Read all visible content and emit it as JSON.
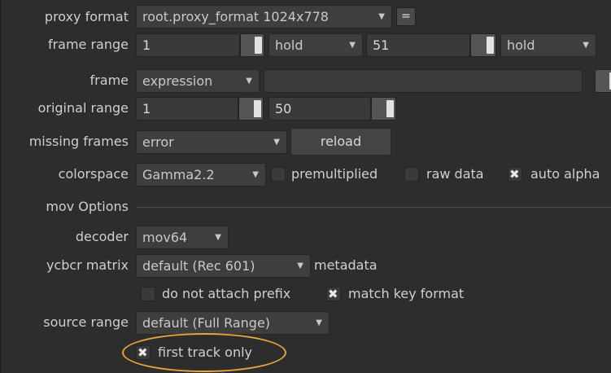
{
  "labels": {
    "proxy_format": "proxy format",
    "frame_range": "frame range",
    "frame": "frame",
    "original_range": "original range",
    "missing_frames": "missing frames",
    "colorspace": "colorspace",
    "mov_options": "mov Options",
    "decoder": "decoder",
    "ycbcr_matrix": "ycbcr matrix",
    "source_range": "source range"
  },
  "proxy_format": {
    "value": "root.proxy_format 1024x778",
    "eq": "="
  },
  "frame_range": {
    "start": "1",
    "start_mode": "hold",
    "end": "51",
    "end_mode": "hold"
  },
  "frame": {
    "mode": "expression",
    "expression": ""
  },
  "original_range": {
    "start": "1",
    "end": "50"
  },
  "missing_frames": {
    "value": "error",
    "reload": "reload"
  },
  "colorspace": {
    "value": "Gamma2.2",
    "premultiplied": {
      "label": "premultiplied",
      "checked": false
    },
    "raw_data": {
      "label": "raw data",
      "checked": false
    },
    "auto_alpha": {
      "label": "auto alpha",
      "checked": true
    }
  },
  "decoder": {
    "value": "mov64"
  },
  "ycbcr_matrix": {
    "value": "default (Rec 601)",
    "metadata": "metadata"
  },
  "do_not_attach_prefix": {
    "label": "do not attach prefix",
    "checked": false
  },
  "match_key_format": {
    "label": "match key format",
    "checked": true
  },
  "source_range": {
    "value": "default (Full Range)"
  },
  "first_track_only": {
    "label": "first track only",
    "checked": true
  },
  "colors": {
    "background": "#2d2d2d",
    "control": "#3e3e3e",
    "highlight": "#e8a63a"
  }
}
